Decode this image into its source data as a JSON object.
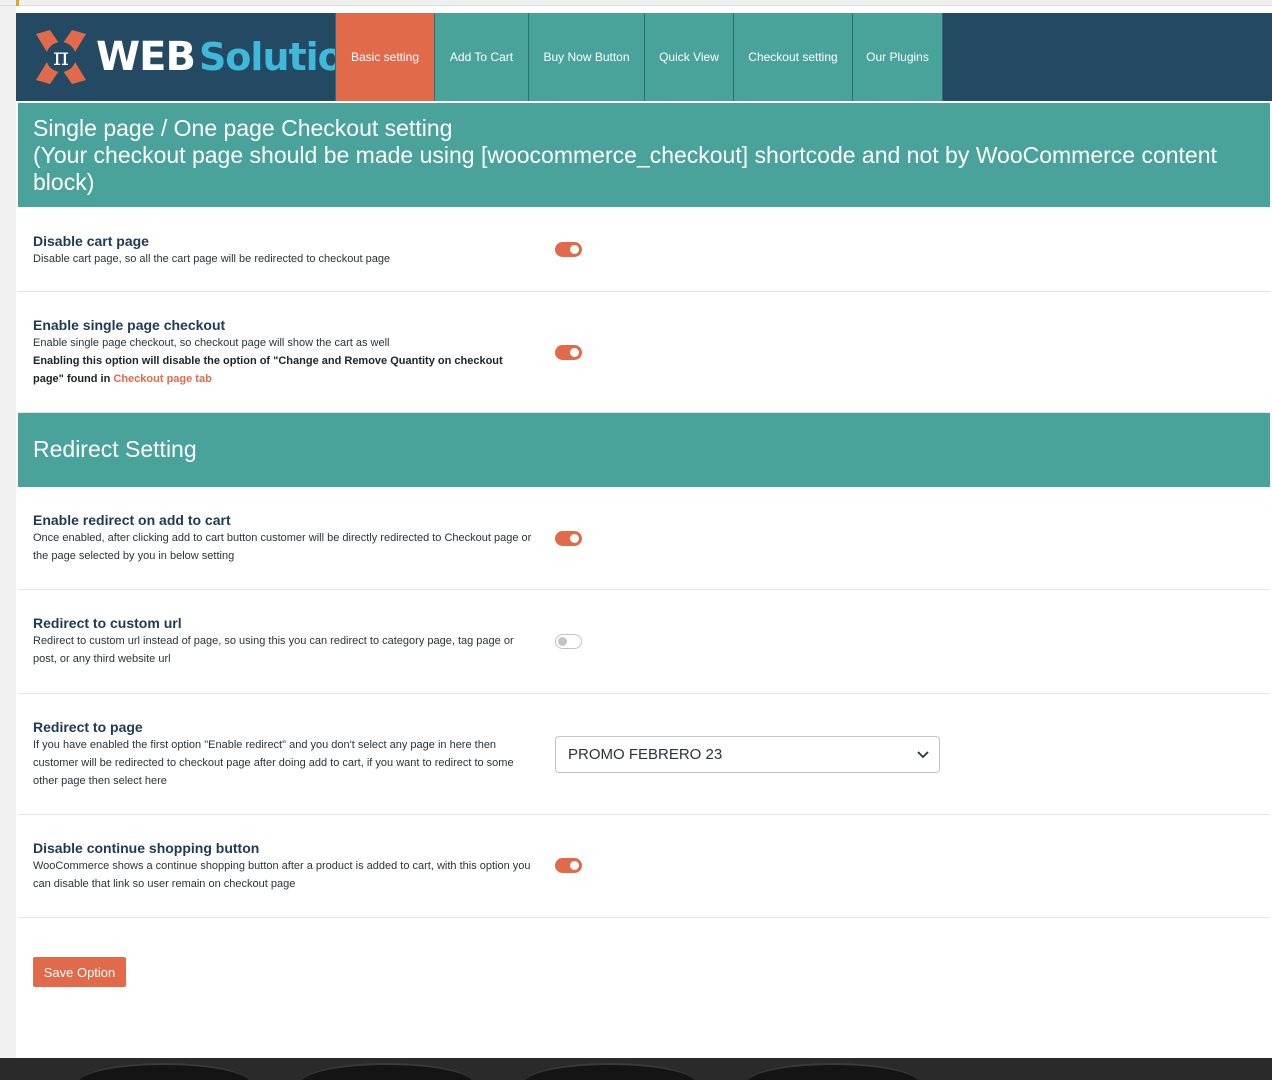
{
  "brand": {
    "logo_symbol": "π",
    "logo_word1": "WEB",
    "logo_word2": "Solution"
  },
  "tabs": [
    {
      "label": "Basic setting",
      "active": true
    },
    {
      "label": "Add To Cart",
      "active": false
    },
    {
      "label": "Buy Now Button",
      "active": false
    },
    {
      "label": "Quick View",
      "active": false
    },
    {
      "label": "Checkout setting",
      "active": false
    },
    {
      "label": "Our Plugins",
      "active": false
    }
  ],
  "section1": {
    "line1": "Single page / One page Checkout setting",
    "line2": "(Your checkout page should be made using [woocommerce_checkout] shortcode and not by WooCommerce content block)"
  },
  "settings1": [
    {
      "title": "Disable cart page",
      "desc": "Disable cart page, so all the cart page will be redirected to checkout page",
      "enabled": true
    },
    {
      "title": "Enable single page checkout",
      "desc": "Enable single page checkout, so checkout page will show the cart as well",
      "note": "Enabling this option will disable the option of \"Change and Remove Quantity on checkout page\" found in",
      "note_link": "Checkout page tab",
      "enabled": true
    }
  ],
  "section2": {
    "title": "Redirect Setting"
  },
  "settings2": [
    {
      "title": "Enable redirect on add to cart",
      "desc": "Once enabled, after clicking add to cart button customer will be directly redirected to Checkout page or the page selected by you in below setting",
      "enabled": true
    },
    {
      "title": "Redirect to custom url",
      "desc": "Redirect to custom url instead of page, so using this you can redirect to category page, tag page or post, or any third website url",
      "enabled": false
    },
    {
      "title": "Redirect to page",
      "desc": "If you have enabled the first option \"Enable redirect\" and you don't select any page in here then customer will be redirected to checkout page after doing add to cart, if you want to redirect to some other page then select here",
      "selected": "PROMO FEBRERO 23"
    },
    {
      "title": "Disable continue shopping button",
      "desc": "WooCommerce shows a continue shopping button after a product is added to cart, with this option you can disable that link so user remain on checkout page",
      "enabled": true
    }
  ],
  "save_label": "Save Option",
  "colors": {
    "header": "#244a63",
    "teal": "#4aa39b",
    "accent": "#e16a4b"
  }
}
